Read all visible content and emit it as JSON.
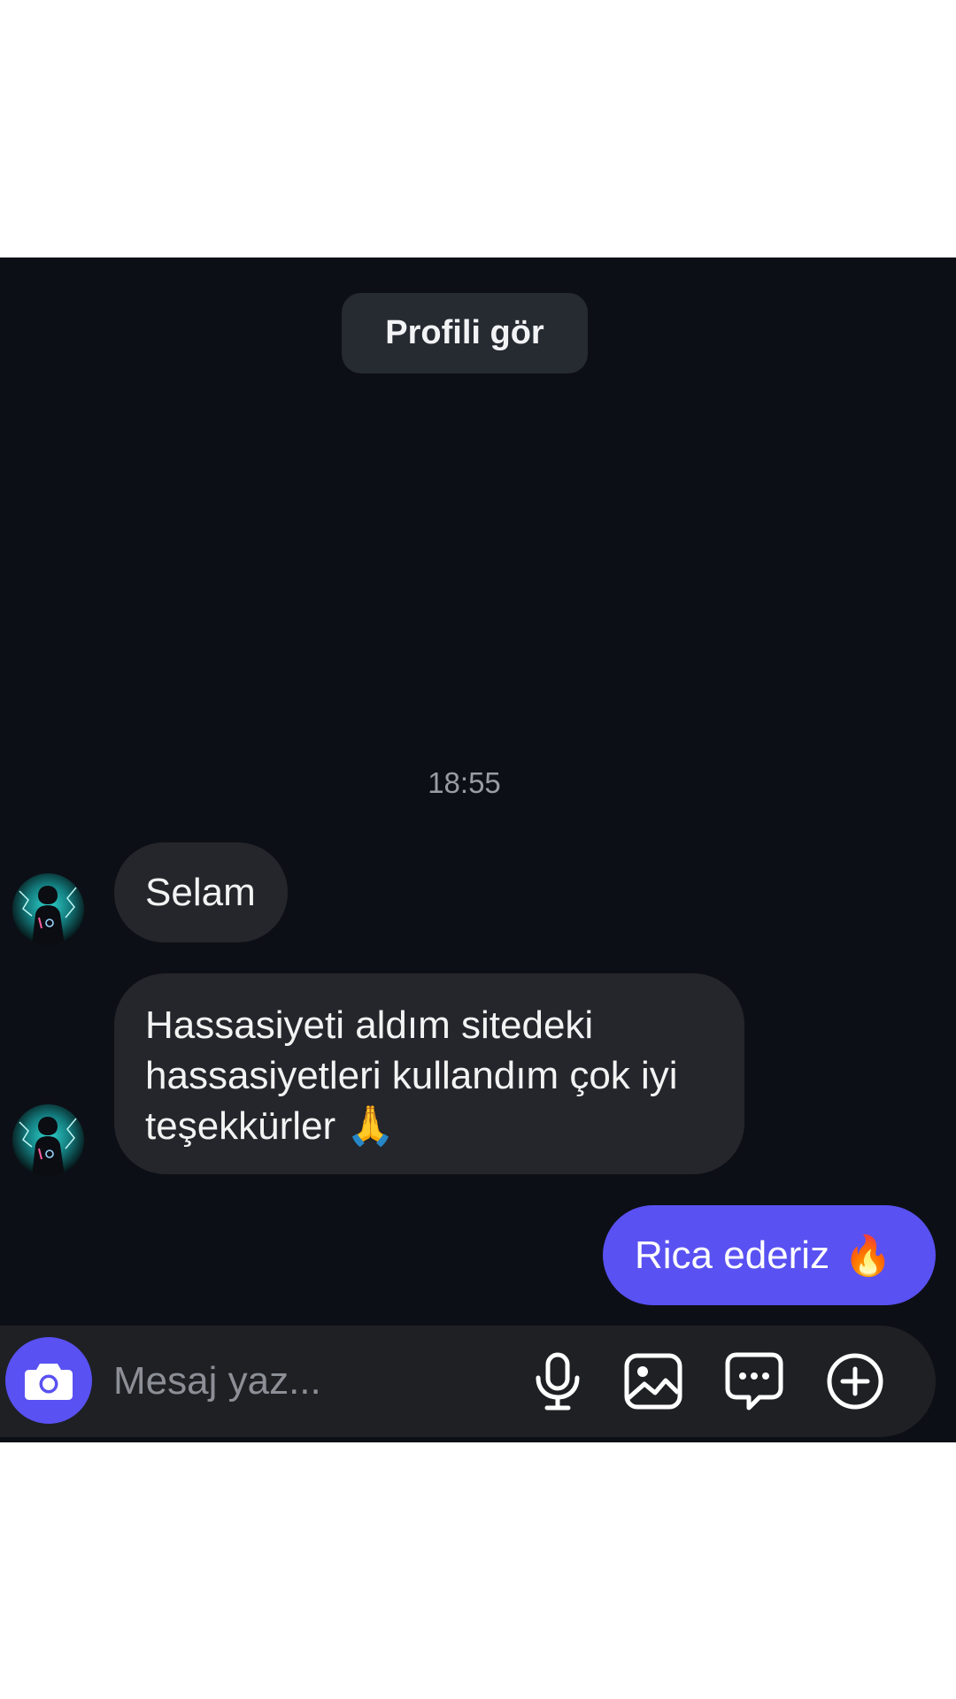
{
  "header": {
    "profile_button_label": "Profili gör"
  },
  "conversation": {
    "timestamp": "18:55",
    "incoming": [
      {
        "text": "Selam"
      },
      {
        "line1": "Hassasiyeti aldım sitedeki",
        "line2": "hassasiyetleri kullandım çok iyi",
        "line3": "teşekkürler",
        "emoji": "🙏"
      }
    ],
    "outgoing": [
      {
        "text": "Rica ederiz",
        "emoji": "🔥"
      }
    ]
  },
  "composer": {
    "placeholder": "Mesaj yaz...",
    "icons": [
      "camera-icon",
      "microphone-icon",
      "image-icon",
      "chat-bubble-icon",
      "add-circle-icon"
    ]
  },
  "colors": {
    "chat_background": "#0d0f16",
    "incoming_bubble": "#24262b",
    "outgoing_bubble": "#5951f2",
    "accent": "#5951f2"
  }
}
